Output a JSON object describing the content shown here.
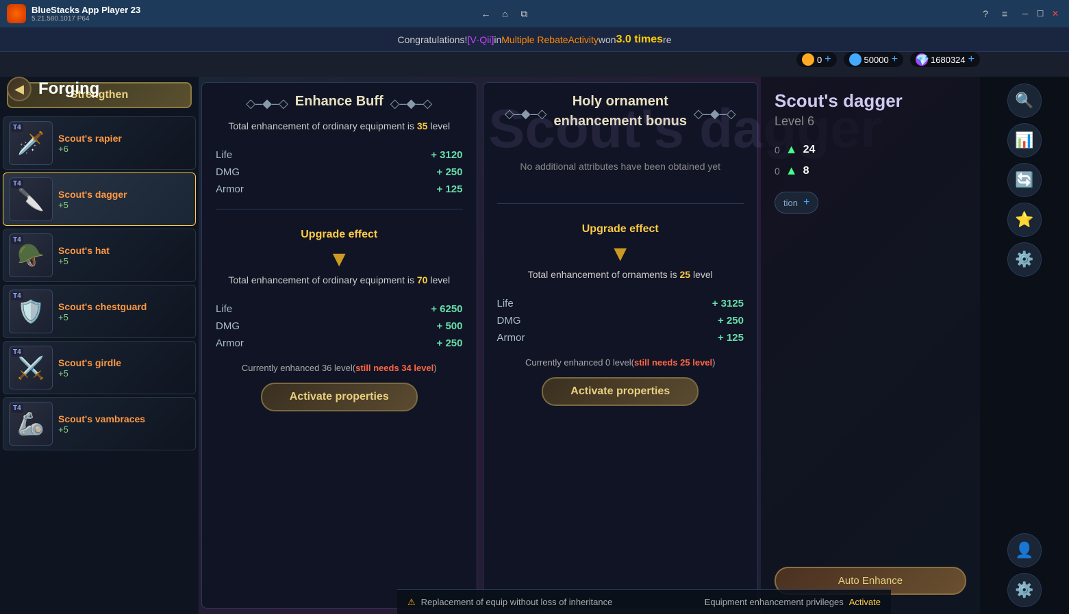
{
  "titleBar": {
    "appName": "BlueStacks App Player 23",
    "appVersion": "5.21.580.1017  P64",
    "backLabel": "←",
    "homeLabel": "⌂",
    "tabLabel": "⧉",
    "helpLabel": "?",
    "menuLabel": "≡",
    "minimizeLabel": "─",
    "maximizeLabel": "☐",
    "closeLabel": "✕"
  },
  "announcement": {
    "prefix": "Congratulations! ",
    "name": "[V·Qii]",
    "middle": " in ",
    "activity": "Multiple RebateActivity",
    "won": " won ",
    "times": "3.0 times",
    "suffix": " re"
  },
  "currency": {
    "coin1": "0",
    "coin2": "50000",
    "gem": "1680324"
  },
  "header": {
    "pageTitle": "Forging",
    "forgingLabel": "• Forging"
  },
  "strengthenBtn": "Strengthen",
  "equipment": {
    "items": [
      {
        "name": "Scout's rapier",
        "tier": "T4",
        "level": "+6",
        "icon": "🗡️",
        "selected": false
      },
      {
        "name": "Scout's dagger",
        "tier": "T4",
        "level": "+5",
        "icon": "🔪",
        "selected": true
      },
      {
        "name": "Scout's hat",
        "tier": "T4",
        "level": "+5",
        "icon": "🪖",
        "selected": false
      },
      {
        "name": "Scout's chestguard",
        "tier": "T4",
        "level": "+5",
        "icon": "🛡️",
        "selected": false
      },
      {
        "name": "Scout's girdle",
        "tier": "T4",
        "level": "+5",
        "icon": "⚔️",
        "selected": false
      },
      {
        "name": "Scout's vambraces",
        "tier": "T4",
        "level": "+5",
        "icon": "🦾",
        "selected": false
      }
    ]
  },
  "enhanceBuff": {
    "title": "Enhance Buff",
    "subtitle": "Total enhancement of ordinary equipment is ",
    "subtitleLevel": "35",
    "subtitleSuffix": " level",
    "stats": {
      "life_label": "Life",
      "life_value": "+ 3120",
      "dmg_label": "DMG",
      "dmg_value": "+ 250",
      "armor_label": "Armor",
      "armor_value": "+ 125"
    },
    "upgradeLabel": "Upgrade effect",
    "upgradeDesc": "Total enhancement of ordinary equipment is ",
    "upgradeDescLevel": "70",
    "upgradeDescSuffix": " level",
    "upgradeStats": {
      "life_label": "Life",
      "life_value": "+ 6250",
      "dmg_label": "DMG",
      "dmg_value": "+ 500",
      "armor_label": "Armor",
      "armor_value": "+ 250"
    },
    "currentStatus": "Currently enhanced 36 level(",
    "stillNeeds": "still needs 34 level",
    "currentSuffix": ")",
    "activateBtn": "Activate properties"
  },
  "holyOrnament": {
    "title": "Holy ornament",
    "titleLine2": "enhancement bonus",
    "subtitle": "No additional attributes have been obtained yet",
    "upgradeLabel": "Upgrade effect",
    "upgradeDesc": "Total enhancement of ornaments is ",
    "upgradeDescLevel": "25",
    "upgradeDescSuffix": " level",
    "upgradeStats": {
      "life_label": "Life",
      "life_value": "+ 3125",
      "dmg_label": "DMG",
      "dmg_value": "+ 250",
      "armor_label": "Armor",
      "armor_value": "+ 125"
    },
    "currentStatus": "Currently enhanced 0 level(",
    "stillNeeds": "still needs 25 level",
    "currentSuffix": ")",
    "activateBtn": "Activate properties"
  },
  "forgingPanel": {
    "equipName": "Scout's dagger",
    "equipLevel": "Level 6",
    "stat1Val": "24",
    "stat2Val": "8"
  },
  "bottomBar": {
    "warningText": "Replacement of equip without loss of inheritance",
    "privilegeText": "Equipment enhancement privileges",
    "activateText": "Activate"
  },
  "rightIcons": [
    "🔍",
    "📊",
    "🔄",
    "🌟",
    "⚙️",
    "👤",
    "⚙️"
  ]
}
